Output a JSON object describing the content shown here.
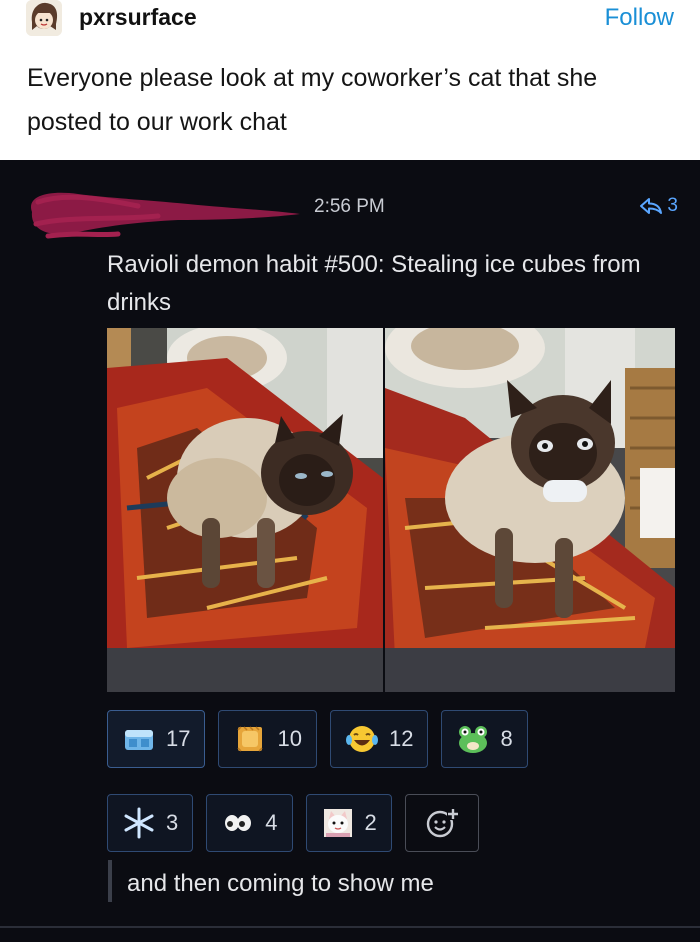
{
  "post": {
    "username": "pxrsurface",
    "follow_label": "Follow",
    "text": "Everyone please look at my coworker’s cat that she posted to our work chat"
  },
  "chat": {
    "timestamp": "2:56 PM",
    "reply_count": "3",
    "message": "Ravioli demon habit #500: Stealing ice cubes from drinks",
    "reactions_row1": [
      {
        "emoji": "ice-cube-icon",
        "count": "17"
      },
      {
        "emoji": "ravioli-icon",
        "count": "10"
      },
      {
        "emoji": "laughing-crying-icon",
        "count": "12"
      },
      {
        "emoji": "frog-icon",
        "count": "8"
      }
    ],
    "reactions_row2": [
      {
        "emoji": "snowflake-icon",
        "count": "3"
      },
      {
        "emoji": "eyes-icon",
        "count": "4"
      },
      {
        "emoji": "cat-meme-icon",
        "count": "2"
      }
    ],
    "reply": "and then coming to show me"
  },
  "colors": {
    "follow": "#1a8fd6",
    "chat_background": "#0b0c12",
    "reaction_border": "#2f4a73",
    "scribble": "#8c1a45"
  }
}
